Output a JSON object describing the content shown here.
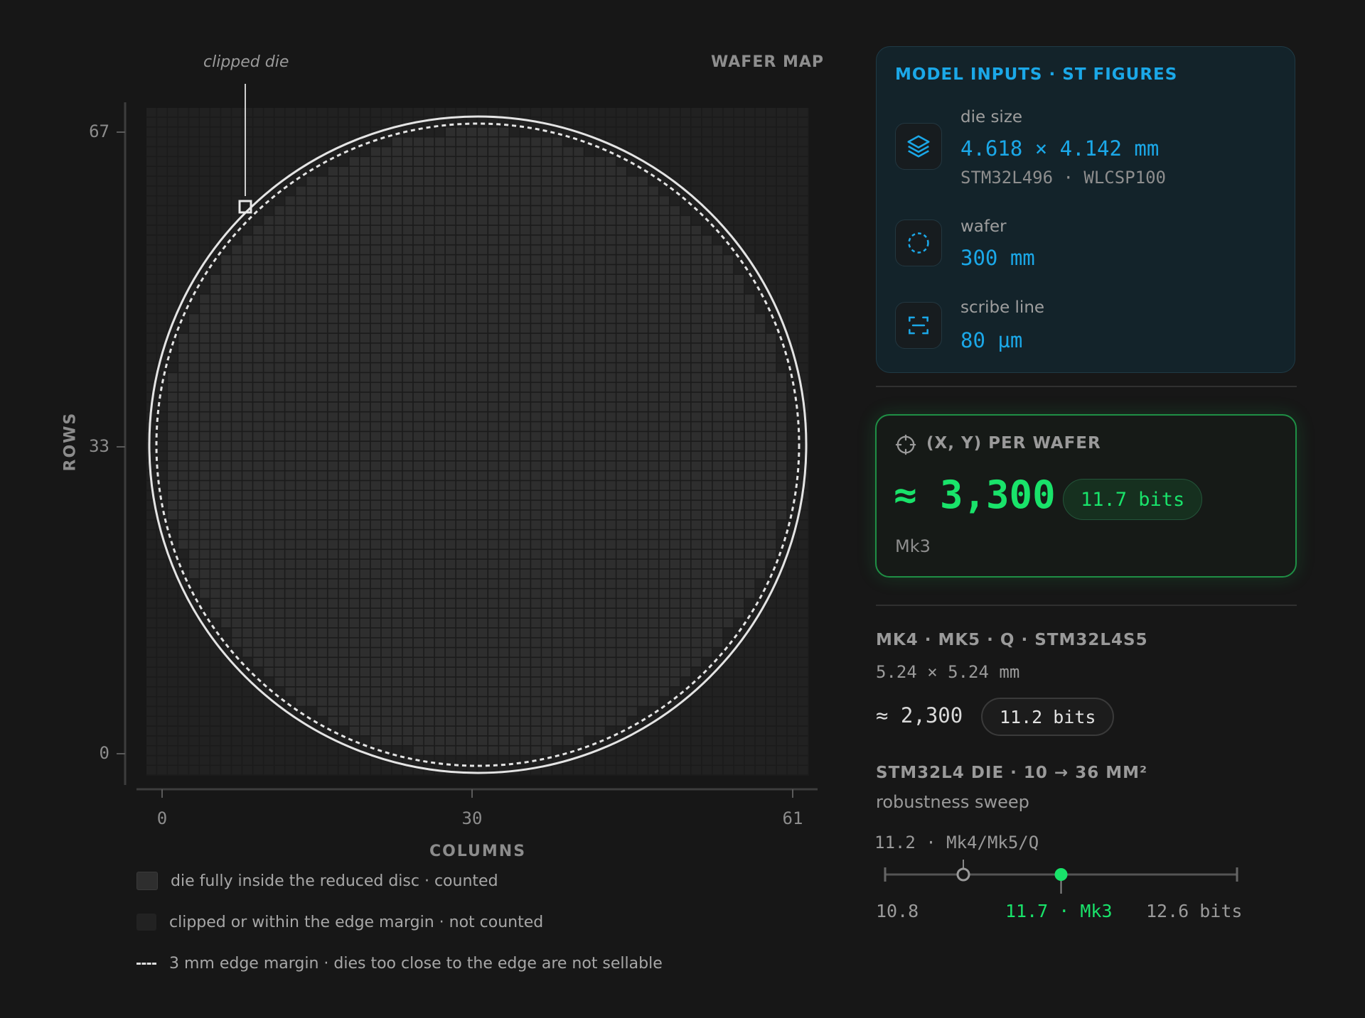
{
  "colors": {
    "background": "#171717",
    "accent_blue": "#1ba8e8",
    "accent_green": "#19e36a",
    "die_counted": "#2e2e2e",
    "die_excluded": "#212121",
    "edge": "#e4e4e4"
  },
  "wafer_map": {
    "panel_title": "WAFER MAP",
    "callout_label": "clipped die",
    "y_axis": {
      "title": "ROWS",
      "ticks": [
        "67",
        "33",
        "0"
      ]
    },
    "x_axis": {
      "title": "COLUMNS",
      "ticks": [
        "0",
        "30",
        "61"
      ]
    },
    "grid": {
      "columns": 62,
      "rows": 68
    },
    "legend": {
      "counted": "die fully inside the reduced disc · counted",
      "excluded": "clipped or within the edge margin · not counted",
      "margin": "3 mm edge margin · dies too close to the edge are not sellable"
    }
  },
  "model_inputs": {
    "title": "MODEL INPUTS · ST FIGURES",
    "die_size": {
      "label": "die size",
      "value": "4.618 × 4.142 mm",
      "sub": "STM32L496 · WLCSP100",
      "icon": "layers-icon"
    },
    "wafer": {
      "label": "wafer",
      "value": "300 mm",
      "icon": "dashed-circle-icon"
    },
    "scribe_line": {
      "label": "scribe line",
      "value": "80 µm",
      "icon": "scribe-bracket-icon"
    }
  },
  "result": {
    "icon": "crosshair-icon",
    "title": "(X, Y) PER WAFER",
    "value": "≈ 3,300",
    "bits": "11.7 bits",
    "footnote": "Mk3"
  },
  "comparison": {
    "title": "MK4 · MK5 · Q · STM32L4S5",
    "size": "5.24 × 5.24 mm",
    "value": "≈ 2,300",
    "bits": "11.2 bits"
  },
  "sweep": {
    "title": "STM32L4 DIE · 10 → 36 MM²",
    "subtitle": "robustness sweep",
    "top_marker_label": "11.2 · Mk4/Mk5/Q",
    "low_label": "10.8",
    "mk3_label": "11.7 · Mk3",
    "high_label": "12.6 bits",
    "min": 10.8,
    "max": 12.6,
    "mk4_value": 11.2,
    "mk3_value": 11.7
  }
}
